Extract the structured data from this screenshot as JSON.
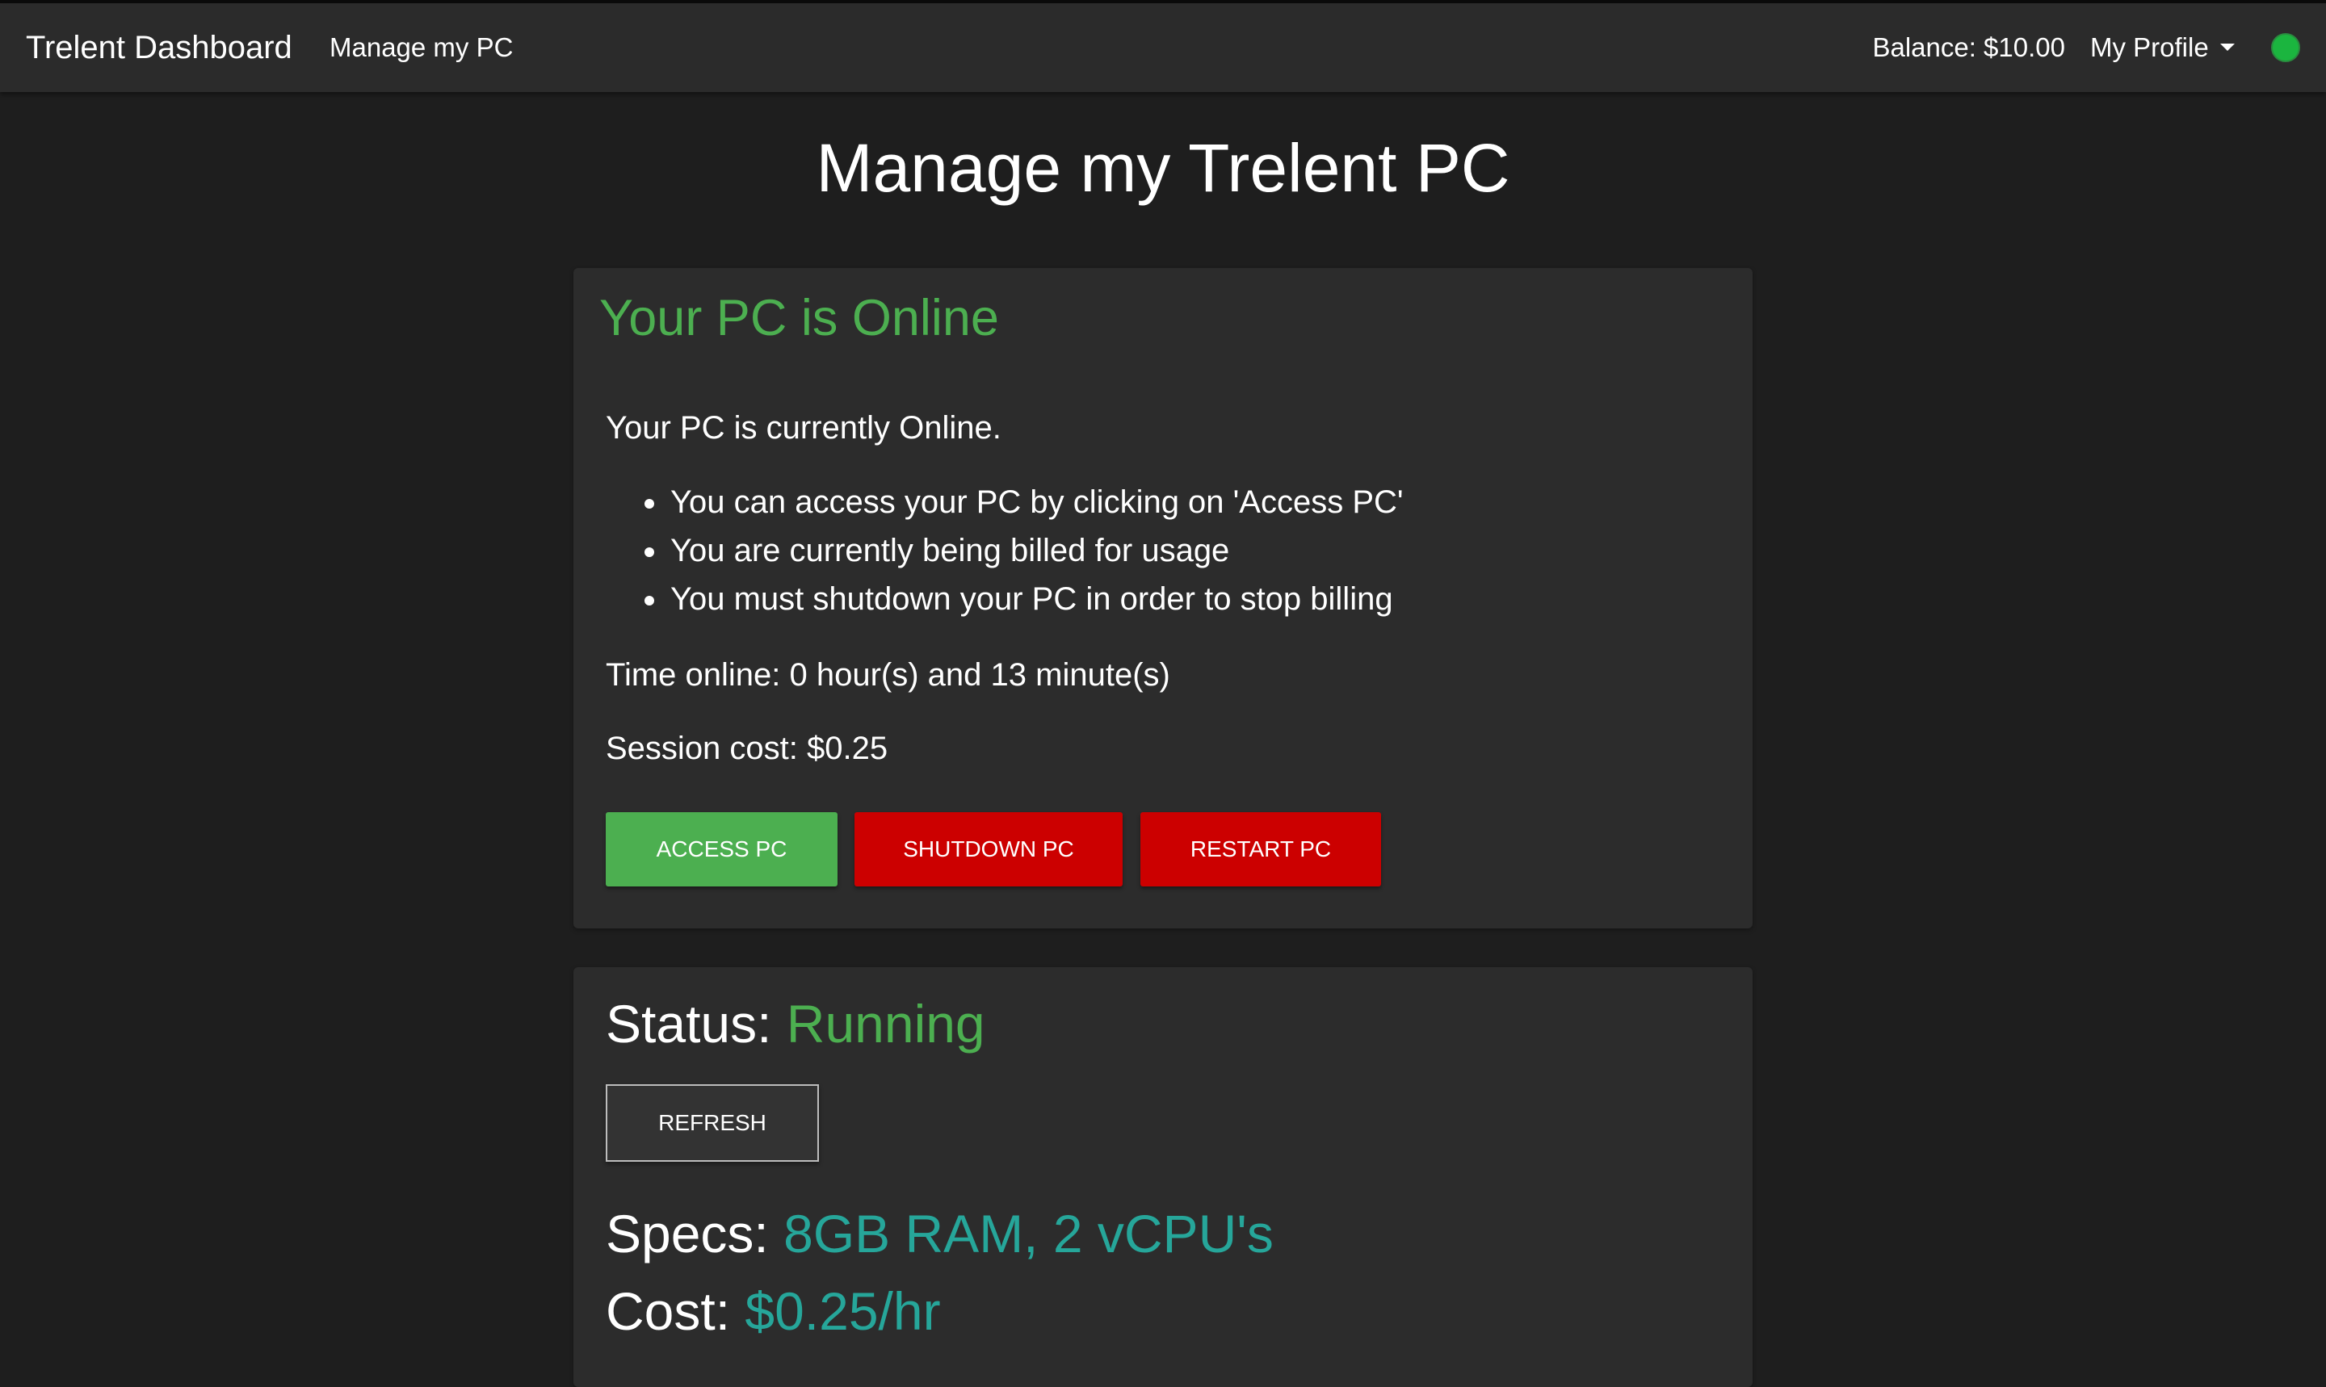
{
  "navbar": {
    "brand": "Trelent Dashboard",
    "manage_link": "Manage my PC",
    "balance": "Balance: $10.00",
    "profile_label": "My Profile",
    "status_color": "#1bb53f"
  },
  "page": {
    "title": "Manage my Trelent PC"
  },
  "pc_card": {
    "heading": "Your PC is Online",
    "intro": "Your PC is currently Online.",
    "bullets": [
      "You can access your PC by clicking on 'Access PC'",
      "You are currently being billed for usage",
      "You must shutdown your PC in order to stop billing"
    ],
    "time_online": "Time online: 0 hour(s) and 13 minute(s)",
    "session_cost": "Session cost: $0.25",
    "buttons": {
      "access": "ACCESS PC",
      "shutdown": "SHUTDOWN PC",
      "restart": "RESTART PC"
    }
  },
  "status_card": {
    "status_label": "Status: ",
    "status_value": "Running",
    "refresh_button": "REFRESH",
    "specs_label": "Specs: ",
    "specs_value": "8GB RAM, 2 vCPU's",
    "cost_label": "Cost: ",
    "cost_value": "$0.25/hr"
  },
  "colors": {
    "accent_green": "#4caf50",
    "danger_red": "#cc0000",
    "teal": "#26a69a",
    "background": "#1e1e1e",
    "card": "#2c2c2c",
    "navbar": "#2b2b2b"
  }
}
